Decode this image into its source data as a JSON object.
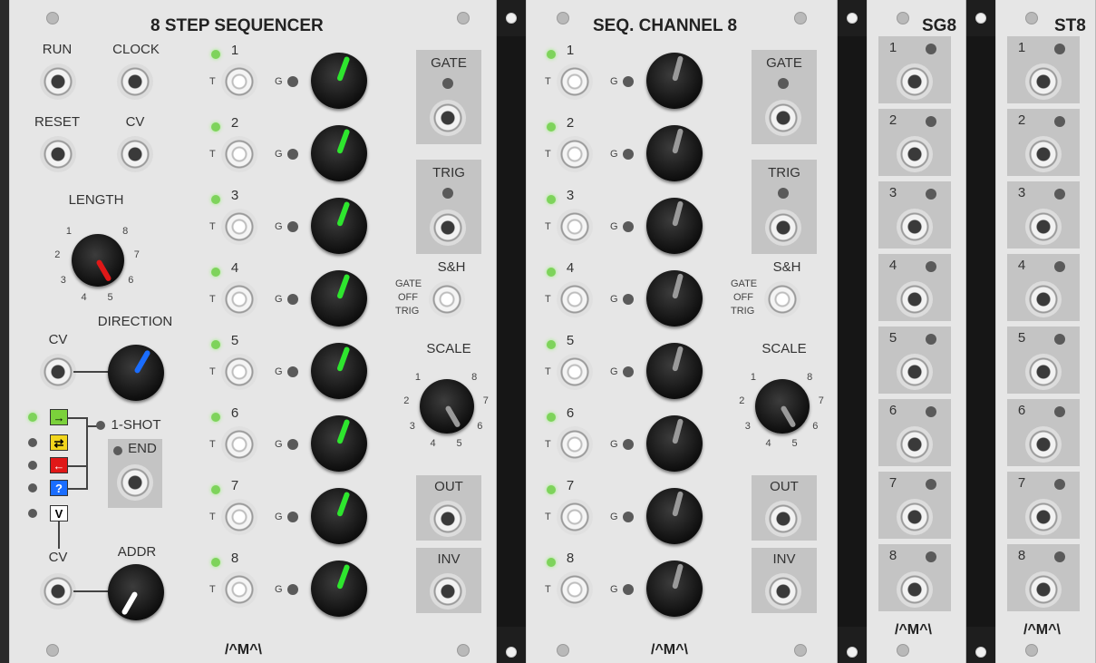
{
  "seq8": {
    "title": "8 STEP SEQUENCER",
    "run_label": "RUN",
    "clock_label": "CLOCK",
    "reset_label": "RESET",
    "cv_label": "CV",
    "length_label": "LENGTH",
    "length_ticks": [
      "1",
      "2",
      "3",
      "4",
      "5",
      "6",
      "7",
      "8"
    ],
    "direction_label": "DIRECTION",
    "dir_cv_label": "CV",
    "oneshot_label": "1-SHOT",
    "end_label": "END",
    "mode_switches": [
      "→",
      "⇄",
      "←",
      "?",
      "V"
    ],
    "addr_cv_label": "CV",
    "addr_label": "ADDR",
    "steps": [
      "1",
      "2",
      "3",
      "4",
      "5",
      "6",
      "7",
      "8"
    ],
    "t_label": "T",
    "g_label": "G",
    "gate_label": "GATE",
    "trig_label": "TRIG",
    "sh_label": "S&H",
    "sh_options": [
      "GATE",
      "OFF",
      "TRIG"
    ],
    "scale_label": "SCALE",
    "scale_ticks": [
      "1",
      "2",
      "3",
      "4",
      "5",
      "6",
      "7",
      "8"
    ],
    "out_label": "OUT",
    "inv_label": "INV",
    "logo": "/^M^\\"
  },
  "chan8": {
    "title": "SEQ. CHANNEL 8",
    "steps": [
      "1",
      "2",
      "3",
      "4",
      "5",
      "6",
      "7",
      "8"
    ],
    "t_label": "T",
    "g_label": "G",
    "gate_label": "GATE",
    "trig_label": "TRIG",
    "sh_label": "S&H",
    "sh_options": [
      "GATE",
      "OFF",
      "TRIG"
    ],
    "scale_label": "SCALE",
    "scale_ticks": [
      "1",
      "2",
      "3",
      "4",
      "5",
      "6",
      "7",
      "8"
    ],
    "out_label": "OUT",
    "inv_label": "INV",
    "logo": "/^M^\\"
  },
  "sg8": {
    "title": "SG8",
    "rows": [
      "1",
      "2",
      "3",
      "4",
      "5",
      "6",
      "7",
      "8"
    ],
    "logo": "/^M^\\"
  },
  "st8": {
    "title": "ST8",
    "rows": [
      "1",
      "2",
      "3",
      "4",
      "5",
      "6",
      "7",
      "8"
    ],
    "logo": "/^M^\\"
  },
  "colors": {
    "panel": "#e6e6e6",
    "green_indicator": "#2ee62e",
    "red_indicator": "#e01818",
    "blue_indicator": "#1a6dff",
    "led_on": "#7ed35b"
  },
  "icons": [
    "screw-icon",
    "jack-icon",
    "knob-icon",
    "led-icon"
  ]
}
